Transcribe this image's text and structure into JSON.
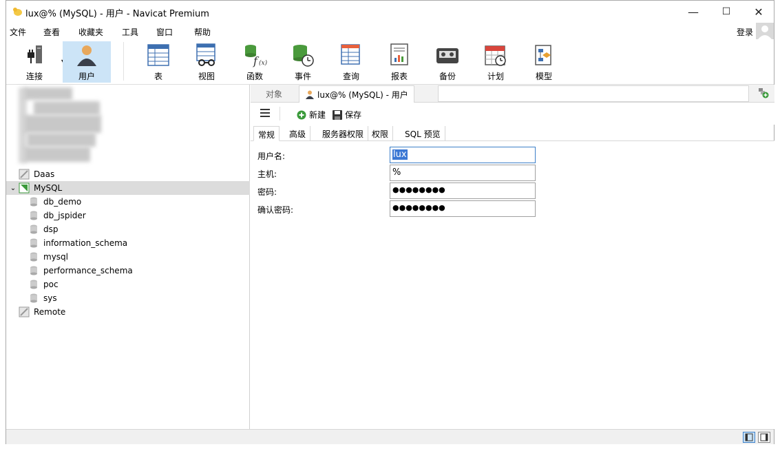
{
  "window": {
    "title": "lux@% (MySQL) - 用户 - Navicat Premium",
    "minimize": "—",
    "maximize": "☐",
    "close": "✕"
  },
  "menu": {
    "items": [
      "文件",
      "查看",
      "收藏夹",
      "工具",
      "窗口",
      "帮助"
    ],
    "login": "登录"
  },
  "toolbar": {
    "tools": [
      {
        "label": "连接",
        "icon": "connection-icon"
      },
      {
        "label": "用户",
        "icon": "user-icon"
      },
      {
        "label": "表",
        "icon": "table-icon"
      },
      {
        "label": "视图",
        "icon": "view-icon"
      },
      {
        "label": "函数",
        "icon": "function-icon"
      },
      {
        "label": "事件",
        "icon": "event-icon"
      },
      {
        "label": "查询",
        "icon": "query-icon"
      },
      {
        "label": "报表",
        "icon": "report-icon"
      },
      {
        "label": "备份",
        "icon": "backup-icon"
      },
      {
        "label": "计划",
        "icon": "schedule-icon"
      },
      {
        "label": "模型",
        "icon": "model-icon"
      }
    ]
  },
  "tree": {
    "connections": [
      "Daas",
      "MySQL",
      "Remote"
    ],
    "databases": [
      "db_demo",
      "db_jspider",
      "dsp",
      "information_schema",
      "mysql",
      "performance_schema",
      "poc",
      "sys"
    ]
  },
  "tabs": {
    "objects": "对象",
    "active": "lux@% (MySQL) - 用户"
  },
  "subtoolbar": {
    "new_label": "新建",
    "save_label": "保存"
  },
  "innertabs": [
    "常规",
    "高级",
    "服务器权限",
    "权限",
    "SQL 预览"
  ],
  "form": {
    "username_label": "用户名:",
    "username_value": "lux",
    "host_label": "主机:",
    "host_value": "%",
    "password_label": "密码:",
    "password_value": "●●●●●●●●",
    "confirm_label": "确认密码:",
    "confirm_value": "●●●●●●●●"
  },
  "colors": {
    "accent": "#cce4f7",
    "selection": "#3b78d4",
    "mysql_green": "#3a9a3a"
  }
}
